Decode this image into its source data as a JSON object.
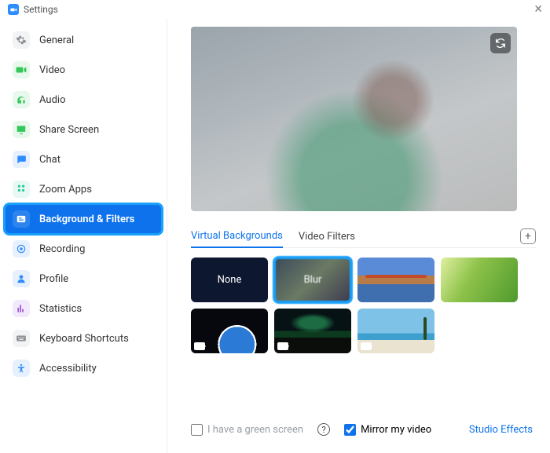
{
  "window": {
    "title": "Settings"
  },
  "sidebar": {
    "items": [
      {
        "label": "General"
      },
      {
        "label": "Video"
      },
      {
        "label": "Audio"
      },
      {
        "label": "Share Screen"
      },
      {
        "label": "Chat"
      },
      {
        "label": "Zoom Apps"
      },
      {
        "label": "Background & Filters"
      },
      {
        "label": "Recording"
      },
      {
        "label": "Profile"
      },
      {
        "label": "Statistics"
      },
      {
        "label": "Keyboard Shortcuts"
      },
      {
        "label": "Accessibility"
      }
    ]
  },
  "tabs": {
    "virtual_backgrounds": "Virtual Backgrounds",
    "video_filters": "Video Filters"
  },
  "backgrounds": {
    "none": "None",
    "blur": "Blur"
  },
  "footer": {
    "green_screen": "I have a green screen",
    "mirror": "Mirror my video",
    "studio_effects": "Studio Effects"
  }
}
